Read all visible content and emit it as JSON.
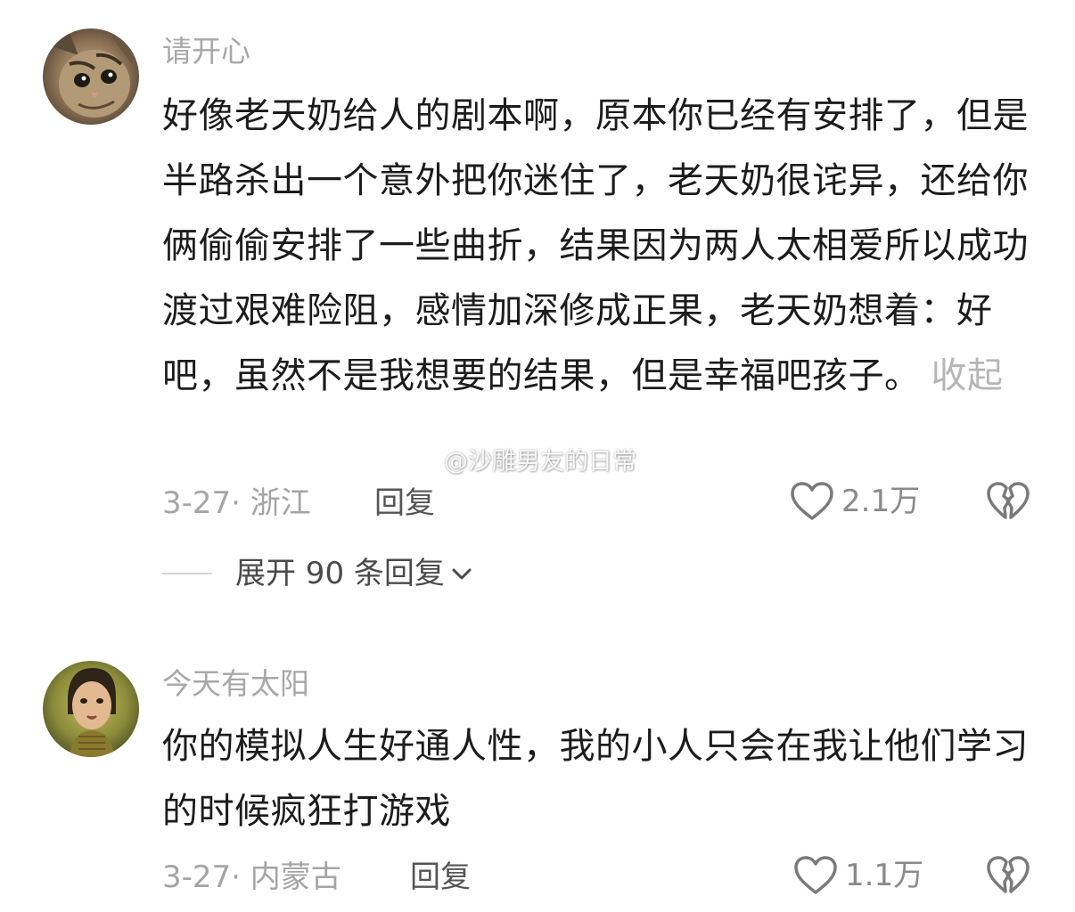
{
  "comments": [
    {
      "username": "请开心",
      "text": "好像老天奶给人的剧本啊，原本你已经有安排了，但是半路杀出一个意外把你迷住了，老天奶很诧异，还给你俩偷偷安排了一些曲折，结果因为两人太相爱所以成功渡过艰难险阻，感情加深修成正果，老天奶想着：好吧，虽然不是我想要的结果，但是幸福吧孩子。",
      "collapse_label": "收起",
      "date_location": "3-27· 浙江",
      "reply_label": "回复",
      "like_count": "2.1万",
      "expand_label": "展开 90 条回复"
    },
    {
      "username": "今天有太阳",
      "text": "你的模拟人生好通人性，我的小人只会在我让他们学习的时候疯狂打游戏",
      "date_location": "3-27· 内蒙古",
      "reply_label": "回复",
      "like_count": "1.1万"
    }
  ],
  "watermark": "@沙雕男友的日常",
  "icons": {
    "like": "heart-outline-icon",
    "dislike": "broken-heart-icon",
    "expand": "chevron-down-icon",
    "watermark": "weibo-logo-icon"
  },
  "colors": {
    "username": "#a8a8a8",
    "body_text": "#1c1c1c",
    "meta": "#a5a5a5",
    "reply": "#555555",
    "icon": "#7a7a7a"
  }
}
